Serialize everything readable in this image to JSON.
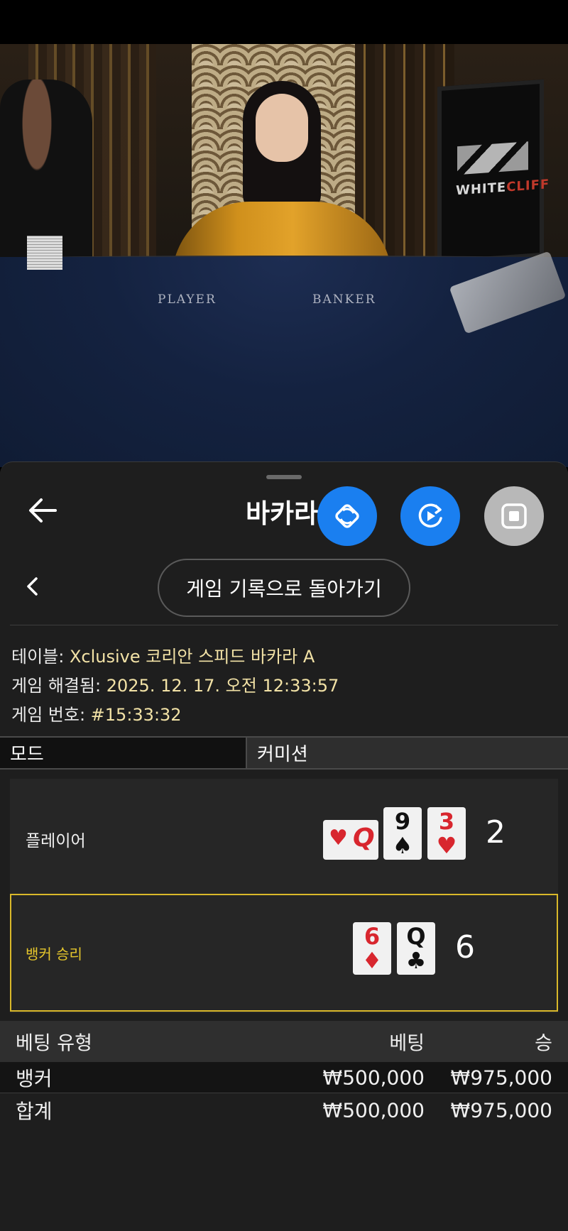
{
  "video": {
    "felt_player": "PLAYER",
    "felt_banker": "BANKER",
    "monitor_logo_a": "WHITE",
    "monitor_logo_b": "CLIFF"
  },
  "sheet": {
    "title": "바카라",
    "back_icon": "arrow-left-icon",
    "fabs": [
      {
        "name": "rotate-icon",
        "color": "#1a7ff0"
      },
      {
        "name": "replay-icon",
        "color": "#1a7ff0"
      },
      {
        "name": "stop-icon",
        "color": "#b8b8b8"
      }
    ],
    "history_button": "게임 기록으로 돌아가기"
  },
  "info": {
    "table_label": "테이블: ",
    "table_value": "Xclusive 코리안 스피드 바카라 A",
    "resolved_label": "게임 해결됨: ",
    "resolved_value": "2025. 12. 17. 오전 12:33:57",
    "number_label": "게임 번호: ",
    "number_value": "#15:33:32"
  },
  "tabs": {
    "mode": "모드",
    "commission": "커미션"
  },
  "results": {
    "player": {
      "label": "플레이어",
      "cards": [
        {
          "rank": "Q",
          "suit": "♥",
          "color": "red",
          "sideways": true
        },
        {
          "rank": "9",
          "suit": "♠",
          "color": "black"
        },
        {
          "rank": "3",
          "suit": "♥",
          "color": "red"
        }
      ],
      "score": "2"
    },
    "banker": {
      "label": "뱅커 승리",
      "cards": [
        {
          "rank": "6",
          "suit": "♦",
          "color": "red"
        },
        {
          "rank": "Q",
          "suit": "♣",
          "color": "black"
        }
      ],
      "score": "6",
      "highlight": "#d9b82a"
    }
  },
  "bets": {
    "header": {
      "type": "베팅 유형",
      "bet": "베팅",
      "win": "승"
    },
    "rows": [
      {
        "type": "뱅커",
        "bet": "₩500,000",
        "win": "₩975,000"
      },
      {
        "type": "합계",
        "bet": "₩500,000",
        "win": "₩975,000"
      }
    ]
  }
}
